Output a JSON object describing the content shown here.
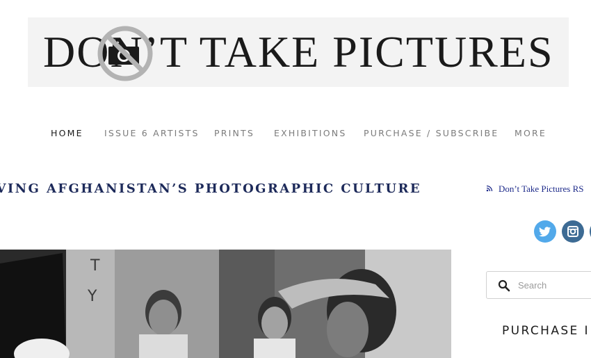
{
  "logo": {
    "text": "DON’T TAKE PICTURES",
    "icon": "no-camera-icon"
  },
  "nav": {
    "items": [
      {
        "label": "HOME",
        "active": true
      },
      {
        "label": "ISSUE 6 ARTISTS",
        "active": false
      },
      {
        "label": "PRINTS",
        "active": false
      },
      {
        "label": "EXHIBITIONS",
        "active": false
      },
      {
        "label": "PURCHASE / SUBSCRIBE",
        "active": false
      },
      {
        "label": "MORE",
        "active": false
      }
    ]
  },
  "post": {
    "title": "RVING AFGHANISTAN’S PHOTOGRAPHIC CULTURE"
  },
  "sidebar": {
    "rss_label": "Don’t Take Pictures RS",
    "social": [
      "twitter-icon",
      "instagram-icon"
    ],
    "search_placeholder": "Search",
    "heading": "PURCHASE I"
  },
  "colors": {
    "title": "#1d2a5a",
    "link": "#1d2a8a",
    "twitter": "#52a9ea",
    "instagram": "#3d6b94",
    "nav_inactive": "#7b7b7b"
  }
}
